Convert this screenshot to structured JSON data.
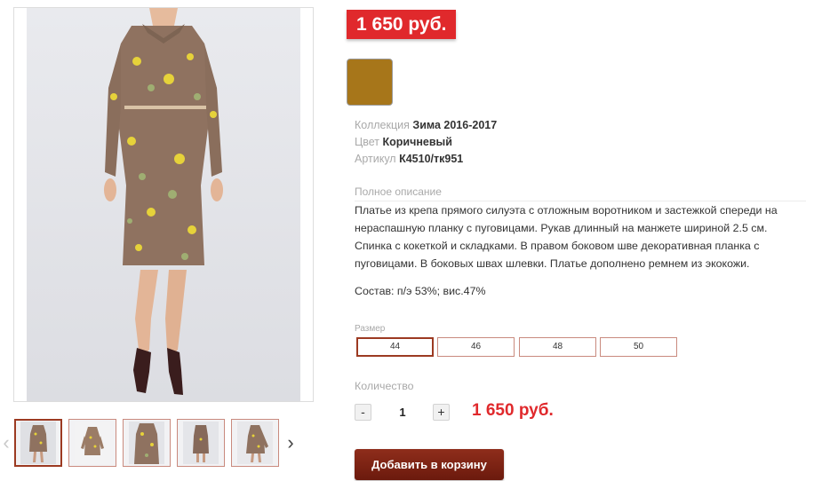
{
  "gallery": {
    "thumbnails": [
      {
        "label": "photo-1",
        "active": true
      },
      {
        "label": "photo-2",
        "active": false
      },
      {
        "label": "photo-3",
        "active": false
      },
      {
        "label": "photo-4",
        "active": false
      },
      {
        "label": "photo-5",
        "active": false
      }
    ],
    "arrow_left": "‹",
    "arrow_right": "›"
  },
  "product": {
    "price": "1 650 руб.",
    "color_swatch_hex": "#a7761a",
    "specs": [
      {
        "label": "Коллекция",
        "value": "Зима 2016-2017"
      },
      {
        "label": "Цвет",
        "value": "Коричневый"
      },
      {
        "label": "Артикул",
        "value": "К4510/тк951"
      }
    ],
    "description_title": "Полное описание",
    "description_lines": [
      "Платье из крепа прямого силуэта с отложным воротником и застежкой спереди на",
      "нераспашную планку с пуговицами. Рукав длинный на манжете шириной 2.5 см.",
      "Спинка с кокеткой и складками. В правом боковом шве декоративная планка с",
      "пуговицами. В боковых швах шлевки. Платье дополнено ремнем из экокожи."
    ],
    "composition": "Состав: п/э 53%; вис.47%",
    "size_label": "Размер",
    "sizes": [
      {
        "label": "44",
        "selected": true
      },
      {
        "label": "46",
        "selected": false
      },
      {
        "label": "48",
        "selected": false
      },
      {
        "label": "50",
        "selected": false
      }
    ],
    "quantity_label": "Количество",
    "quantity_minus": "-",
    "quantity_value": "1",
    "quantity_plus": "+",
    "total_price": "1 650 руб.",
    "add_to_cart": "Добавить в корзину"
  },
  "colors": {
    "accent_red": "#e0292c",
    "button_brown": "#8f2d1b",
    "border_rose": "#c98a7e",
    "selected_border": "#9c3a22"
  }
}
